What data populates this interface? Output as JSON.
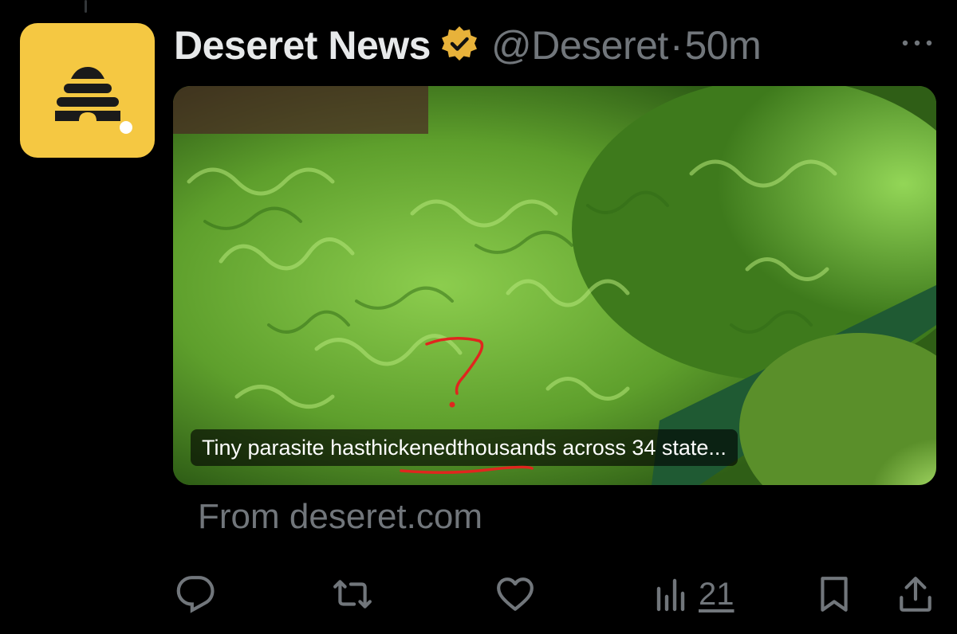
{
  "post": {
    "author_name": "Deseret News",
    "handle": "@Deseret",
    "separator": "·",
    "time": "50m",
    "verified": true,
    "avatar_icon": "beehive-icon",
    "card": {
      "caption_before": "Tiny parasite has ",
      "caption_marked": "thickened",
      "caption_after": " thousands across 34 state..."
    },
    "source": "From deseret.com",
    "actions": {
      "reply_icon": "reply-icon",
      "repost_icon": "repost-icon",
      "like_icon": "heart-icon",
      "views_icon": "views-icon",
      "views_count": "21",
      "bookmark_icon": "bookmark-icon",
      "share_icon": "share-icon"
    }
  },
  "colors": {
    "background": "#000000",
    "text": "#e7e9ea",
    "secondary": "#71767b",
    "verified_badge": "#e8b23a",
    "avatar_bg": "#f5c842",
    "scribble": "#e0261e"
  }
}
